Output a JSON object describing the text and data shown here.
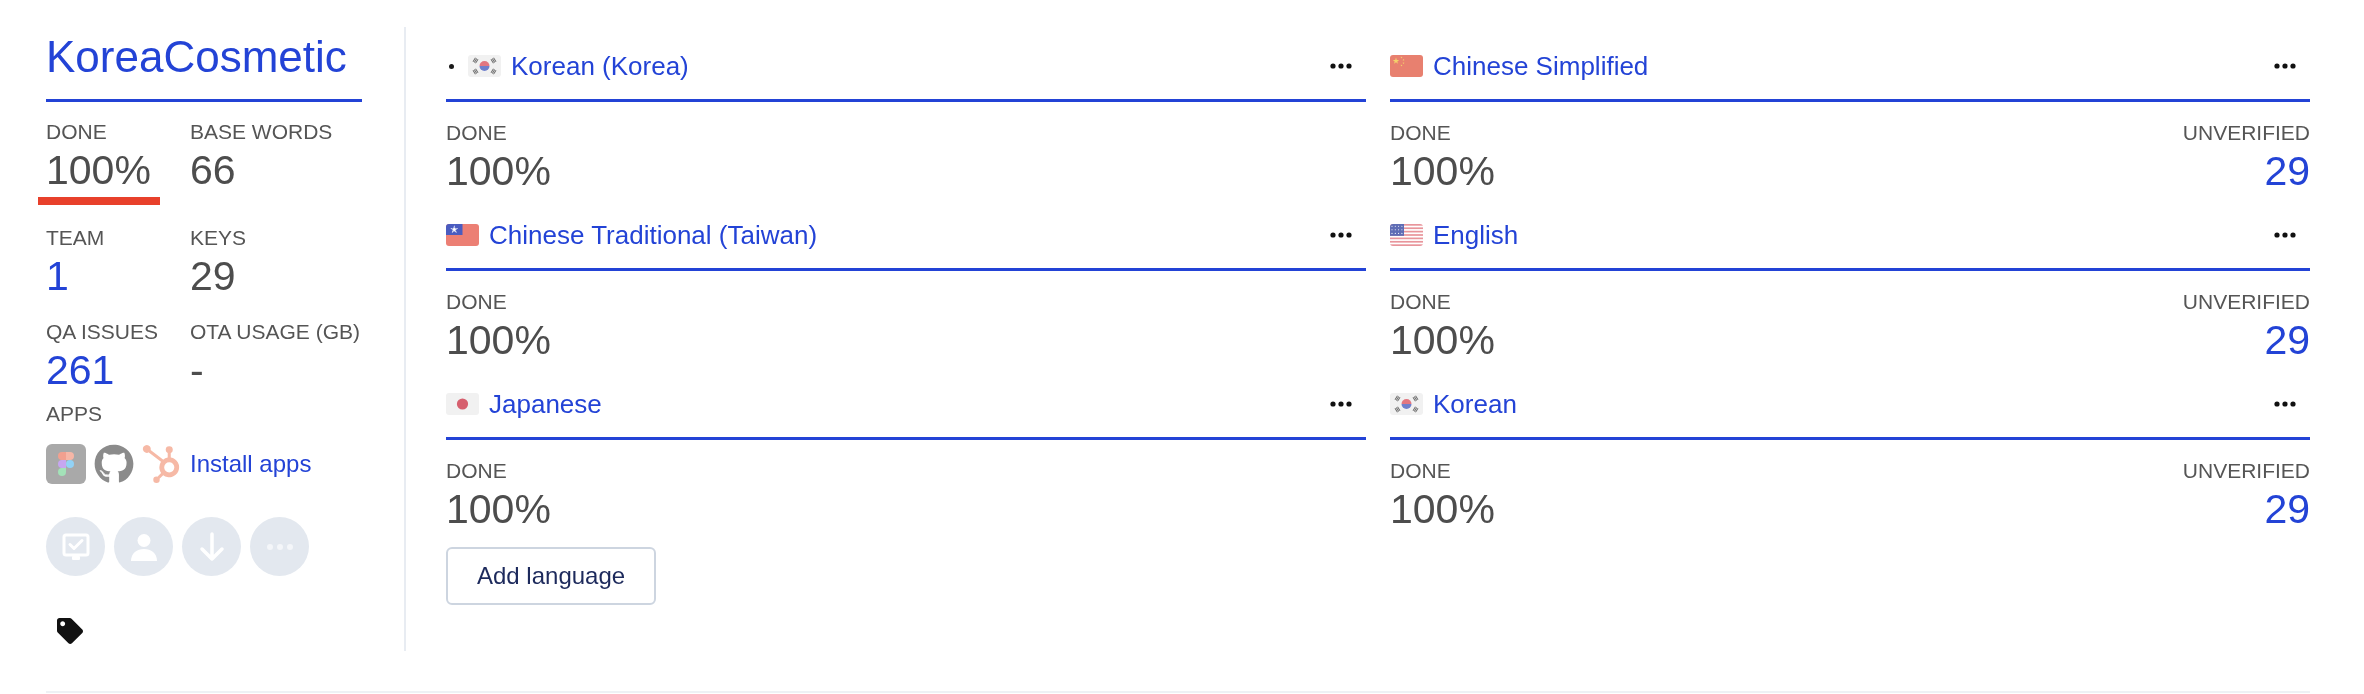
{
  "project": {
    "title": "KoreaCosmetic",
    "stats": [
      {
        "label": "DONE",
        "value": "100%",
        "link": false,
        "level": 1
      },
      {
        "label": "BASE WORDS",
        "value": "66",
        "link": false
      },
      {
        "label": "TEAM",
        "value": "1",
        "link": true
      },
      {
        "label": "KEYS",
        "value": "29",
        "link": false
      },
      {
        "label": "QA ISSUES",
        "value": "261",
        "link": true
      },
      {
        "label": "OTA USAGE (GB)",
        "value": "-",
        "link": false
      }
    ],
    "apps": {
      "label": "APPS",
      "install_link": "Install apps"
    }
  },
  "languages": [
    {
      "name": "Korean (Korea)",
      "kind": "kr",
      "base": true,
      "done": {
        "label": "DONE",
        "value": "100%"
      }
    },
    {
      "name": "Chinese Simplified",
      "kind": "cn",
      "base": false,
      "done": {
        "label": "DONE",
        "value": "100%"
      },
      "unverified": {
        "label": "UNVERIFIED",
        "value": "29"
      }
    },
    {
      "name": "Chinese Traditional (Taiwan)",
      "kind": "tw",
      "base": false,
      "done": {
        "label": "DONE",
        "value": "100%"
      }
    },
    {
      "name": "English",
      "kind": "us",
      "base": false,
      "done": {
        "label": "DONE",
        "value": "100%"
      },
      "unverified": {
        "label": "UNVERIFIED",
        "value": "29"
      }
    },
    {
      "name": "Japanese",
      "kind": "jp",
      "base": false,
      "done": {
        "label": "DONE",
        "value": "100%"
      }
    },
    {
      "name": "Korean",
      "kind": "kr",
      "base": false,
      "done": {
        "label": "DONE",
        "value": "100%"
      },
      "unverified": {
        "label": "UNVERIFIED",
        "value": "29"
      }
    }
  ],
  "add_language_button": "Add language"
}
